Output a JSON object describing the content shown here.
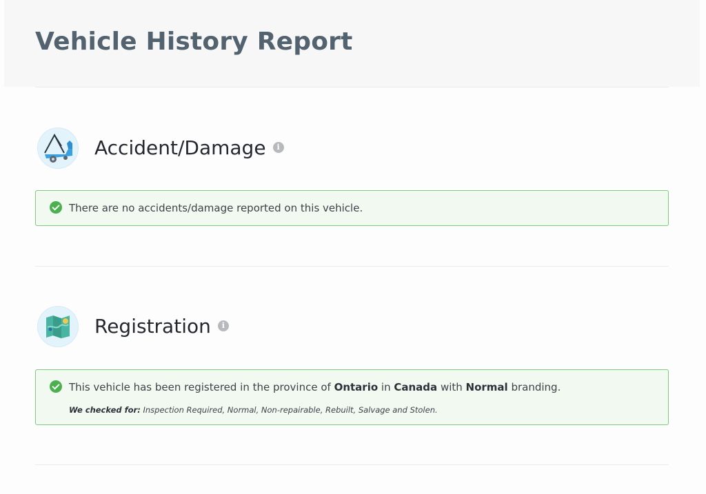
{
  "header": {
    "title": "Vehicle History Report"
  },
  "sections": [
    {
      "title": "Accident/Damage",
      "icon": "tow-truck-icon",
      "message": "There are no accidents/damage reported on this vehicle."
    },
    {
      "title": "Registration",
      "icon": "map-icon",
      "message_parts": {
        "prefix": "This vehicle has been registered in the province of ",
        "province": "Ontario",
        "in": " in ",
        "country": "Canada",
        "with": " with ",
        "branding": "Normal",
        "suffix": " branding."
      },
      "checked_for_label": "We checked for:",
      "checked_for_values": " Inspection Required, Normal, Non-repairable, Rebuilt, Salvage and Stolen."
    }
  ],
  "colors": {
    "success": "#4bb04e",
    "alert_border": "#7ccb7e",
    "alert_bg": "#f1f9f1",
    "title": "#53626f"
  }
}
